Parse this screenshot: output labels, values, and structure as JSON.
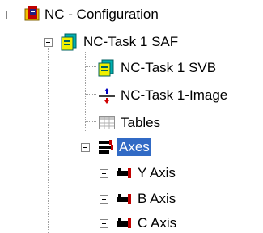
{
  "tree": {
    "root": {
      "label": "NC - Configuration",
      "icon": "nc-config-icon",
      "expanded": true
    },
    "task": {
      "label": "NC-Task 1 SAF",
      "icon": "task-icon",
      "expanded": true
    },
    "svb": {
      "label": "NC-Task 1 SVB",
      "icon": "task-icon"
    },
    "image": {
      "label": "NC-Task 1-Image",
      "icon": "image-icon"
    },
    "tables": {
      "label": "Tables",
      "icon": "table-icon"
    },
    "axes": {
      "label": "Axes",
      "icon": "axes-icon",
      "expanded": true,
      "selected": true
    },
    "y_axis": {
      "label": "Y Axis",
      "icon": "axis-icon",
      "expanded": false
    },
    "b_axis": {
      "label": "B Axis",
      "icon": "axis-icon",
      "expanded": false
    },
    "c_axis": {
      "label": "C Axis",
      "icon": "axis-icon",
      "expanded": true
    }
  },
  "colors": {
    "selection_bg": "#316ac5",
    "selection_text": "#ffffff",
    "tree_line": "#a0a0a0",
    "task_icon": "#00a0a0",
    "axis_icon": "#cc0000"
  }
}
